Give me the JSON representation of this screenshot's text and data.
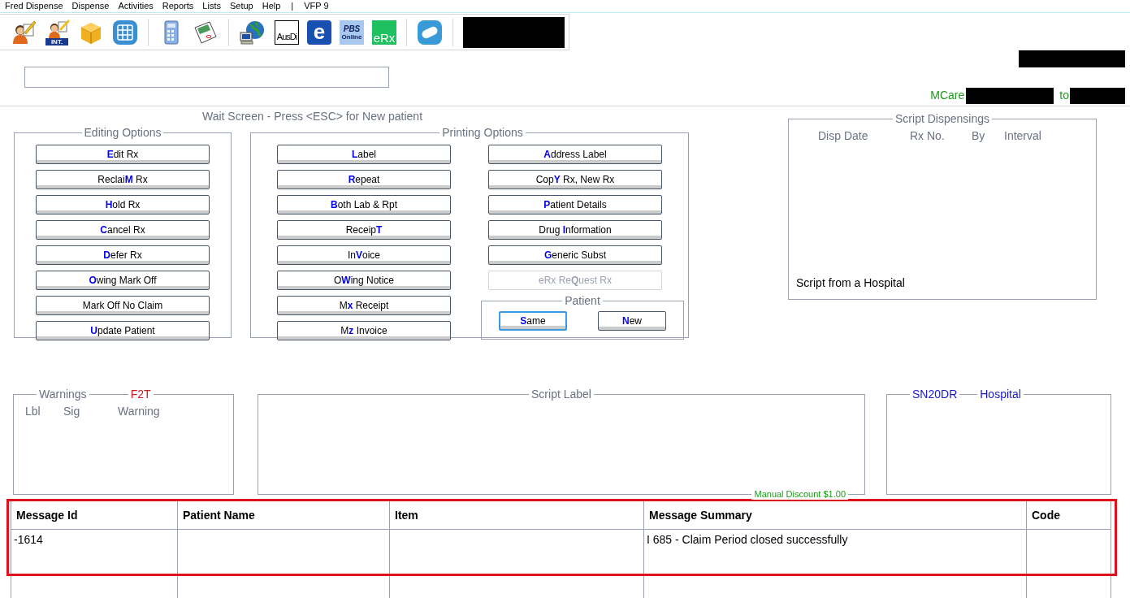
{
  "menu": [
    {
      "kind": "item",
      "label": "Fred Dispense"
    },
    {
      "kind": "item",
      "label": "Dispense"
    },
    {
      "kind": "item",
      "label": "Activities"
    },
    {
      "kind": "item",
      "label": "Reports"
    },
    {
      "kind": "item",
      "label": "Lists"
    },
    {
      "kind": "item",
      "label": "Setup"
    },
    {
      "kind": "item",
      "label": "Help"
    },
    {
      "kind": "separator",
      "label": "|"
    },
    {
      "kind": "item",
      "label": "VFP 9"
    }
  ],
  "toolbar": [
    {
      "kind": "person-pen"
    },
    {
      "kind": "person-int",
      "label": "INT."
    },
    {
      "kind": "box"
    },
    {
      "kind": "grid"
    },
    {
      "kind": "separator"
    },
    {
      "kind": "calculator"
    },
    {
      "kind": "notepad"
    },
    {
      "kind": "separator"
    },
    {
      "kind": "globe"
    },
    {
      "kind": "ausdi",
      "label": "AusDi"
    },
    {
      "kind": "e-logo",
      "label": "e"
    },
    {
      "kind": "pbs",
      "label": "PBS",
      "sublabel": "Online"
    },
    {
      "kind": "erx",
      "label": "eRx"
    },
    {
      "kind": "separator"
    },
    {
      "kind": "pill"
    },
    {
      "kind": "separator"
    },
    {
      "kind": "redacted"
    }
  ],
  "medicare": {
    "label": "MCare",
    "to": "to"
  },
  "wait_title": "Wait Screen - Press <ESC> for New patient",
  "editing_options": {
    "title": "Editing Options",
    "buttons": [
      {
        "label": "**E**dit Rx",
        "disabled": false
      },
      {
        "label": "Reclai**M** Rx",
        "disabled": false
      },
      {
        "label": "**H**old Rx",
        "disabled": false
      },
      {
        "label": "**C**ancel Rx",
        "disabled": false
      },
      {
        "label": "**D**efer Rx",
        "disabled": false
      },
      {
        "label": "**O**wing Mark Off",
        "disabled": false
      },
      {
        "label": "Mark Off No Claim",
        "disabled": false
      },
      {
        "label": "**U**pdate Patient",
        "disabled": false
      }
    ]
  },
  "printing_options": {
    "title": "Printing Options",
    "column_1": [
      {
        "label": "**L**abel",
        "disabled": false
      },
      {
        "label": "**R**epeat",
        "disabled": false
      },
      {
        "label": "**B**oth Lab & Rpt",
        "disabled": false
      },
      {
        "label": "Receip**T**",
        "disabled": false
      },
      {
        "label": "In**V**oice",
        "disabled": false
      },
      {
        "label": "O**W**ing Notice",
        "disabled": false
      },
      {
        "label": "M**x** Receipt",
        "disabled": false
      },
      {
        "label": "M**z** Invoice",
        "disabled": false
      }
    ],
    "column_2": [
      {
        "label": "**A**ddress Label",
        "disabled": false
      },
      {
        "label": "Cop**Y** Rx, New Rx",
        "disabled": false
      },
      {
        "label": "**P**atient Details",
        "disabled": false
      },
      {
        "label": "Drug **I**nformation",
        "disabled": false
      },
      {
        "label": "**G**eneric Subst",
        "disabled": false
      },
      {
        "label": "eRx Re**Q**uest Rx",
        "disabled": true
      }
    ],
    "patient": {
      "title": "Patient",
      "buttons": [
        {
          "label": "**S**ame",
          "focused": true
        },
        {
          "label": "**N**ew",
          "focused": false
        }
      ]
    }
  },
  "script_dispensings": {
    "title": "Script Dispensings",
    "columns": [
      "Disp Date",
      "Rx No.",
      "By",
      "Interval"
    ],
    "note": "Script from a Hospital"
  },
  "warnings": {
    "title": "Warnings",
    "code": "F2T",
    "columns": [
      "Lbl",
      "Sig",
      "Warning"
    ]
  },
  "script_label": {
    "title": "Script Label",
    "discount": "Manual Discount $1.00"
  },
  "script_info": {
    "code": "SN20DR",
    "source": "Hospital"
  },
  "messages": {
    "columns": [
      "Message Id",
      "Patient Name",
      "Item",
      "Message Summary",
      "Code"
    ],
    "rows": [
      [
        "-1614",
        "",
        "",
        "I 685 - Claim Period closed successfully",
        ""
      ]
    ]
  }
}
